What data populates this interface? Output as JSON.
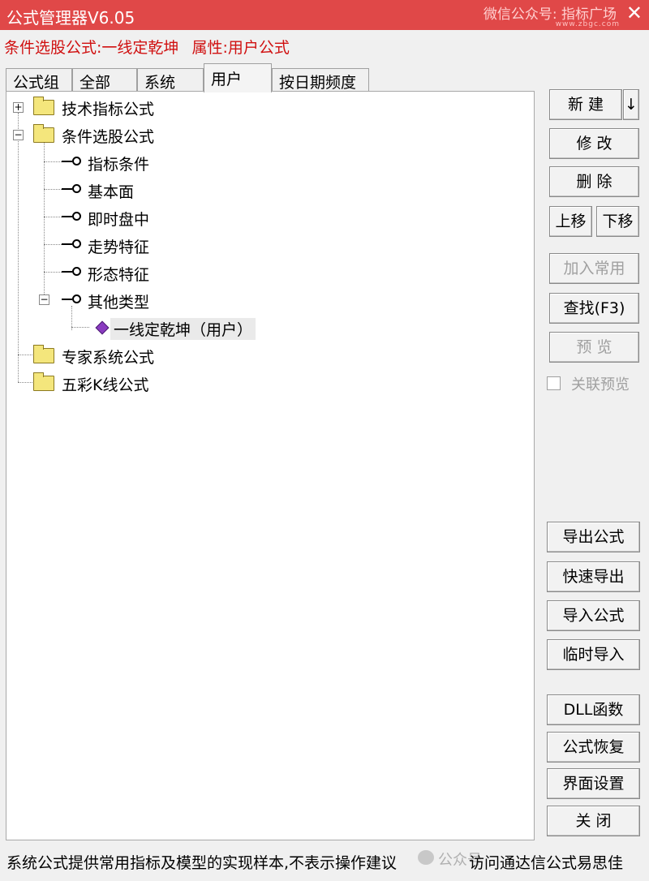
{
  "window": {
    "title": "公式管理器V6.05",
    "watermark_top": "微信公众号: 指标广场",
    "watermark_url": "www.zbgc.com"
  },
  "info": {
    "selection_label": "条件选股公式:一线定乾坤",
    "property_label": "属性:用户公式"
  },
  "tabs": [
    "公式组",
    "全部",
    "系统",
    "用户",
    "按日期频度"
  ],
  "active_tab": "用户",
  "tree": {
    "tech": "技术指标公式",
    "cond": "条件选股公式",
    "cond_children": [
      "指标条件",
      "基本面",
      "即时盘中",
      "走势特征",
      "形态特征",
      "其他类型"
    ],
    "formula": "一线定乾坤（用户）",
    "expert": "专家系统公式",
    "color_k": "五彩K线公式",
    "expander_plus": "+",
    "expander_minus": "−"
  },
  "buttons": {
    "new": "新 建",
    "new_arrow": "↓",
    "modify": "修 改",
    "delete": "删 除",
    "move_up": "上移",
    "move_down": "下移",
    "add_common": "加入常用",
    "find": "查找(F3)",
    "preview": "预 览",
    "linked_preview": "关联预览",
    "export": "导出公式",
    "quick_export": "快速导出",
    "import": "导入公式",
    "temp_import": "临时导入",
    "dll": "DLL函数",
    "restore": "公式恢复",
    "ui_settings": "界面设置",
    "close": "关 闭"
  },
  "status": {
    "left": "系统公式提供常用指标及模型的实现样本,不表示操作建议",
    "watermark": "公众号",
    "right": "访问通达信公式易思佳"
  },
  "colors": {
    "titlebar": "#e04848",
    "info_text": "#d01010",
    "folder": "#f4e67c",
    "gem": "#8a3bc0"
  }
}
